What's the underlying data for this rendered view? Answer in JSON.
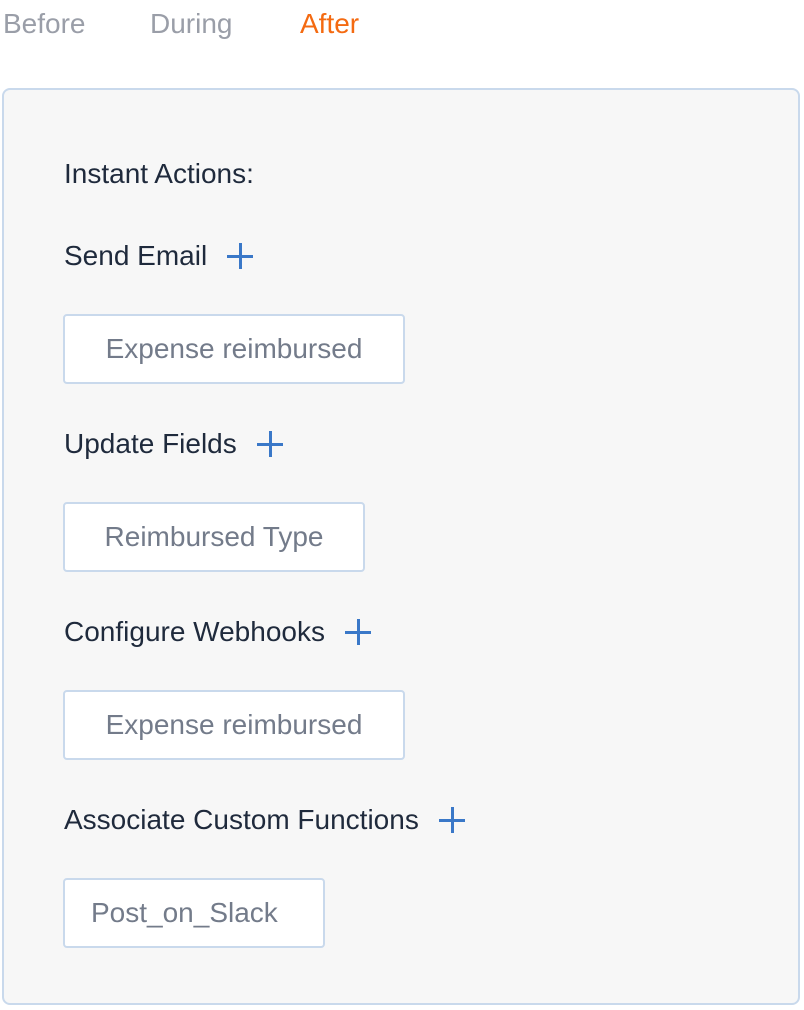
{
  "tabs": [
    {
      "label": "Before",
      "active": false
    },
    {
      "label": "During",
      "active": false
    },
    {
      "label": "After",
      "active": true
    }
  ],
  "panel": {
    "heading": "Instant Actions:",
    "sections": [
      {
        "label": "Send Email",
        "add_icon": "plus-icon",
        "items": [
          "Expense reimbursed"
        ]
      },
      {
        "label": "Update Fields",
        "add_icon": "plus-icon",
        "items": [
          "Reimbursed Type"
        ]
      },
      {
        "label": "Configure Webhooks",
        "add_icon": "plus-icon",
        "items": [
          "Expense reimbursed"
        ]
      },
      {
        "label": "Associate Custom Functions",
        "add_icon": "plus-icon",
        "items": [
          "Post_on_Slack"
        ]
      }
    ]
  },
  "colors": {
    "active_tab": "#f46a11",
    "inactive_tab": "#9a9ea8",
    "accent_plus": "#3a78c8",
    "panel_border": "#c9d9ec",
    "panel_bg": "#f7f7f7"
  }
}
